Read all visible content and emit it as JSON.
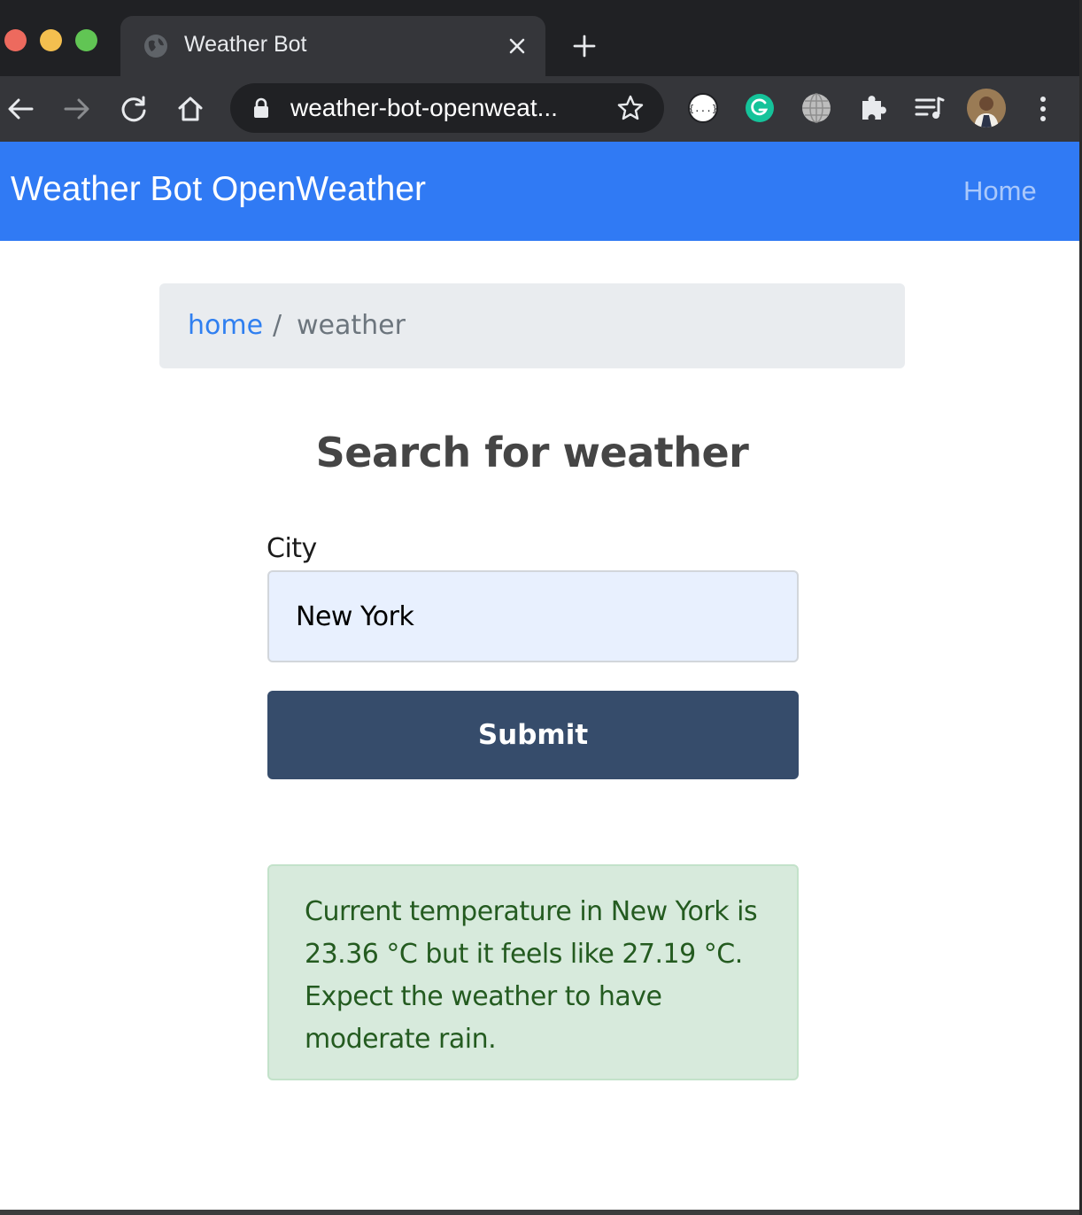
{
  "browser": {
    "tab": {
      "title": "Weather Bot"
    },
    "address_bar": {
      "url": "weather-bot-openweat..."
    },
    "colors": {
      "tabstrip": "#202124",
      "toolbar": "#35363a",
      "omnibox": "#202124"
    },
    "toolbar_icons": [
      "back-icon",
      "forward-icon",
      "reload-icon",
      "home-icon",
      "lock-icon",
      "star-icon"
    ],
    "extension_icons": [
      "json-extension-icon",
      "grammarly-icon",
      "globe-extension-icon",
      "puzzle-icon",
      "media-playlist-icon",
      "profile-avatar",
      "kebab-menu-icon"
    ]
  },
  "navbar": {
    "brand": "Weather Bot OpenWeather",
    "home_link": "Home",
    "background_color": "#307af4"
  },
  "breadcrumb": {
    "home": "home",
    "separator": "/",
    "current": "weather"
  },
  "form": {
    "heading": "Search for weather",
    "city_label": "City",
    "city_value": "New York",
    "submit_label": "Submit",
    "submit_color": "#364c6b"
  },
  "result": {
    "message": "Current temperature in New York is 23.36 °C but it feels like 27.19 °C. Expect the weather to have moderate rain.",
    "background_color": "#d7eadc",
    "text_color": "#245b20"
  }
}
